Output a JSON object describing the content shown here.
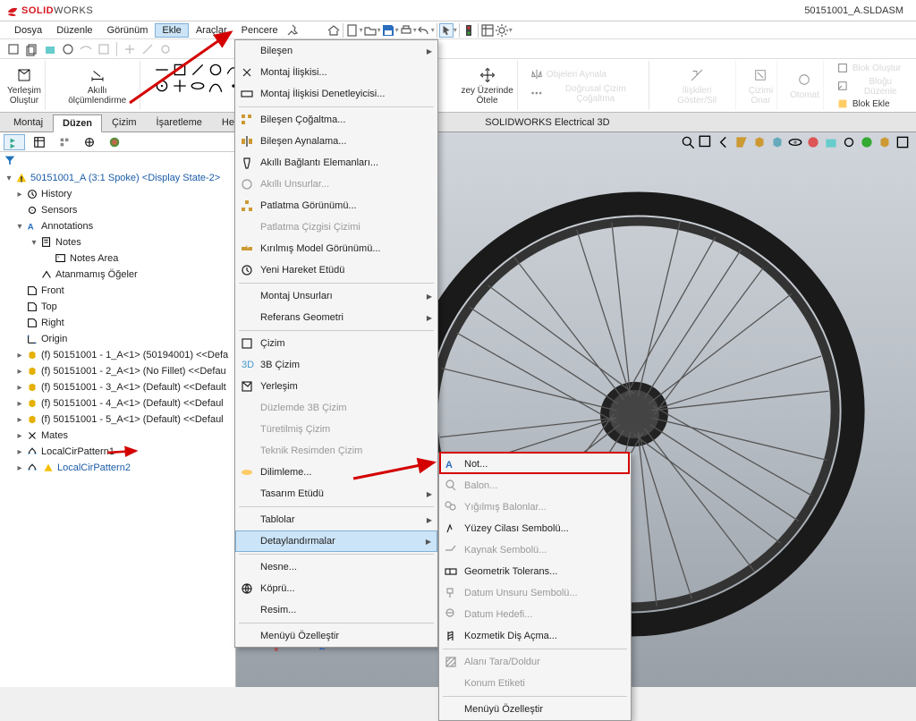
{
  "app": {
    "brand_solid": "SOLID",
    "brand_works": "WORKS",
    "doc": "50151001_A.SLDASM"
  },
  "menu": {
    "file": "Dosya",
    "edit": "Düzenle",
    "view": "Görünüm",
    "insert": "Ekle",
    "tools": "Araçlar",
    "window": "Pencere"
  },
  "ribbon": {
    "layout_create": "Yerleşim\nOluştur",
    "smart_dim": "Akıllı ölçümlendirme",
    "surface_push": "zey Üzerinde\nÖtele",
    "mirror_objects": "Objeleri Aynala",
    "linear_copy": "Doğrusal Çizim Çoğaltma",
    "rel_show_hide": "İlişkileri Göster/Sil",
    "sketch_repair": "Çizimi\nOnar",
    "auto_something": "Otomat",
    "block_create": "Blok Oluştur",
    "block_edit": "Bloğu Düzenle",
    "block_add": "Blok Ekle"
  },
  "tabs": {
    "montaj": "Montaj",
    "duzen": "Düzen",
    "cizim": "Çizim",
    "isaretleme": "İşaretleme",
    "hesap": "Hesapla",
    "elec3d": "SOLIDWORKS Electrical 3D"
  },
  "tree": {
    "root": "50151001_A (3:1 Spoke) <Display State-2>",
    "history": "History",
    "sensors": "Sensors",
    "annotations": "Annotations",
    "notes": "Notes",
    "notes_area": "Notes Area",
    "unassigned": "Atanmamış Öğeler",
    "front": "Front",
    "top": "Top",
    "right": "Right",
    "origin": "Origin",
    "c1": "(f) 50151001 - 1_A<1> (50194001) <<Defa",
    "c2": "(f) 50151001 - 2_A<1> (No Fillet) <<Defau",
    "c3": "(f) 50151001 - 3_A<1> (Default) <<Default",
    "c4": "(f) 50151001 - 4_A<1> (Default) <<Defaul",
    "c5": "(f) 50151001 - 5_A<1> (Default) <<Defaul",
    "mates": "Mates",
    "lcp1": "LocalCirPattern1",
    "lcp2": "LocalCirPattern2"
  },
  "insert_menu": {
    "component": "Bileşen",
    "mate": "Montaj İlişkisi...",
    "mate_controller": "Montaj İlişkisi Denetleyicisi...",
    "comp_pattern": "Bileşen Çoğaltma...",
    "comp_mirror": "Bileşen Aynalama...",
    "smart_fasteners": "Akıllı Bağlantı Elemanları...",
    "smart_features": "Akıllı Unsurlar...",
    "exploded_view": "Patlatma Görünümü...",
    "explode_line": "Patlatma Çizgisi Çizimi",
    "break_view": "Kırılmış Model Görünümü...",
    "motion_study": "Yeni Hareket Etüdü",
    "assy_features": "Montaj Unsurları",
    "ref_geom": "Referans Geometri",
    "sketch2d": "Çizim",
    "sketch3d": "3B Çizim",
    "layout": "Yerleşim",
    "sketch_on_plane": "Düzlemde 3B Çizim",
    "derived_sketch": "Türetilmiş Çizim",
    "drawing_sketch": "Teknik Resimden Çizim",
    "slice": "Dilimleme...",
    "design_study": "Tasarım Etüdü",
    "tables": "Tablolar",
    "annotations": "Detaylandırmalar",
    "object": "Nesne...",
    "hyperlink": "Köprü...",
    "picture": "Resim...",
    "customize": "Menüyü Özelleştir"
  },
  "annot_menu": {
    "note": "Not...",
    "balloon": "Balon...",
    "stacked_balloon": "Yığılmış Balonlar...",
    "surface_finish": "Yüzey Cilası Sembolü...",
    "weld_symbol": "Kaynak Sembolü...",
    "geo_tol": "Geometrik Tolerans...",
    "datum_feature": "Datum Unsuru Sembolü...",
    "datum_target": "Datum Hedefi...",
    "cosmetic_thread": "Kozmetik Diş Açma...",
    "area_hatch": "Alanı Tara/Doldur",
    "location_label": "Konum Etiketi",
    "customize": "Menüyü Özelleştir"
  }
}
